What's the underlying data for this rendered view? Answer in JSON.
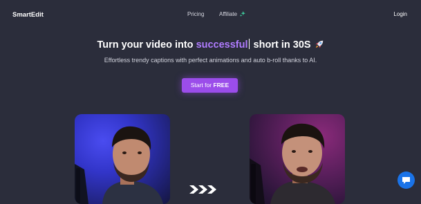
{
  "navbar": {
    "brand": "SmartEdit",
    "links": [
      {
        "label": "Pricing"
      },
      {
        "label": "Affiliate"
      }
    ],
    "login": "Login"
  },
  "hero": {
    "title_before": "Turn your video into ",
    "title_accent": "successful",
    "title_after": " short in 30S",
    "subtitle": "Effortless trendy captions with perfect animations and auto b-roll thanks to AI.",
    "cta_prefix": "Start for ",
    "cta_bold": "FREE"
  },
  "colors": {
    "background": "#2b2d3b",
    "accent": "#b07cff",
    "cta": "#9b4dea",
    "chat": "#1a73e8"
  },
  "icons": [
    "sparkle-icon",
    "rocket-icon",
    "triple-chevron-right-icon",
    "chat-bubble-icon"
  ]
}
